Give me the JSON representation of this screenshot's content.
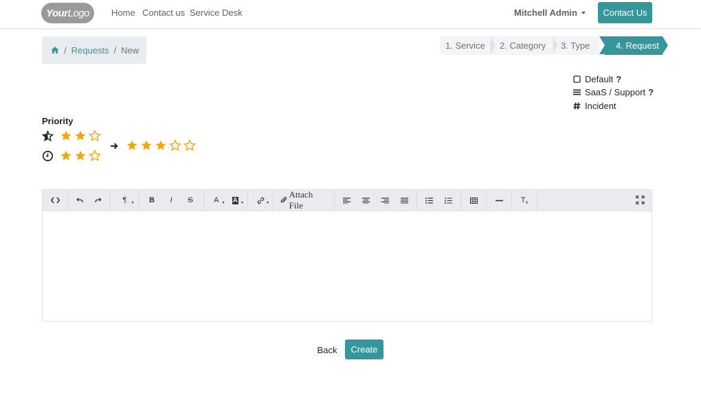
{
  "header": {
    "logo_text_bold": "Your",
    "logo_text_light": "Logo",
    "nav": [
      {
        "label": "Home"
      },
      {
        "label": "Contact us"
      },
      {
        "label": "Service Desk"
      }
    ],
    "user_name": "Mitchell Admin",
    "contact_button": "Contact Us"
  },
  "breadcrumb": {
    "home_icon": "home-icon",
    "separator": "/",
    "items": [
      {
        "label": "Requests"
      },
      {
        "label": "New"
      }
    ]
  },
  "steps": [
    {
      "label": "1. Service"
    },
    {
      "label": "2. Category"
    },
    {
      "label": "3. Type"
    },
    {
      "label": "4. Request"
    }
  ],
  "info": {
    "default_label": "Default",
    "saas_label": "SaaS / Support",
    "incident_label": "Incident",
    "help_mark": "?"
  },
  "priority": {
    "label": "Priority",
    "rows": [
      {
        "icon": "half-star-icon",
        "filled": 2,
        "total": 3
      },
      {
        "icon": "clock-icon",
        "filled": 2,
        "total": 3
      }
    ],
    "result": {
      "filled": 3,
      "total": 5
    }
  },
  "editor": {
    "attach_label": "Attach File",
    "body_text": ""
  },
  "actions": {
    "back_label": "Back",
    "create_label": "Create"
  },
  "colors": {
    "accent": "#35979c",
    "star": "#f3a40f",
    "muted": "#6c757d"
  }
}
